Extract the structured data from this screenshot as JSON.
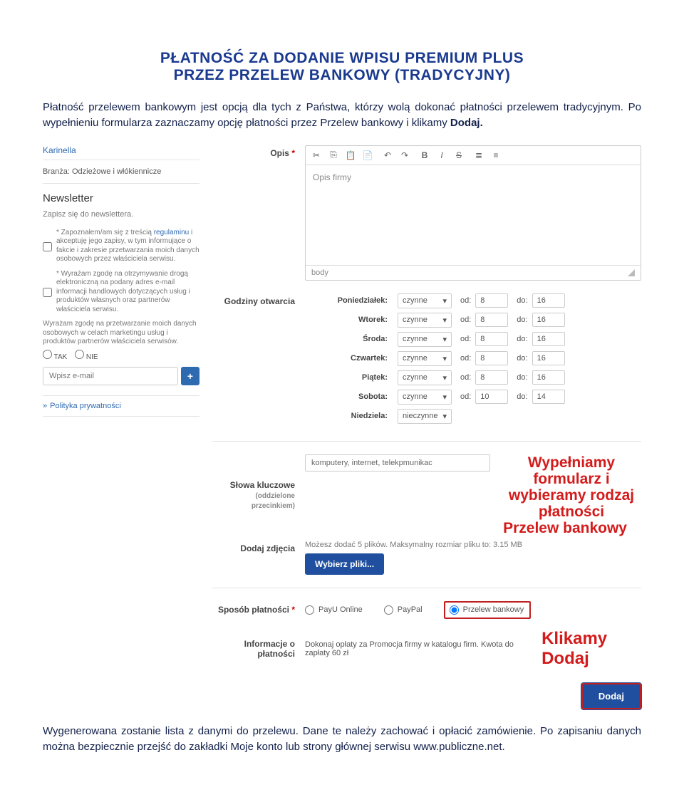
{
  "doc": {
    "title1": "PŁATNOŚĆ ZA DODANIE WPISU PREMIUM PLUS",
    "title2": "PRZEZ PRZELEW BANKOWY (TRADYCYJNY)",
    "para1_pre": "Płatność przelewem bankowym jest opcją dla tych z Państwa, którzy wolą dokonać płatności przelewem tradycyjnym. Po wypełnieniu formularza zaznaczamy opcję płatności przez Przelew bankowy i klikamy ",
    "para1_bold": "Dodaj.",
    "para2": "Wygenerowana zostanie lista z danymi do przelewu. Dane te należy zachować i opłacić zamówienie. Po zapisaniu danych można bezpiecznie przejść do zakładki Moje konto lub strony głównej serwisu www.publiczne.net."
  },
  "sidebar": {
    "breadcrumb": "Karinella",
    "branza_label": "Branża:",
    "branza_value": "Odzieżowe i włókiennicze",
    "newsletter_heading": "Newsletter",
    "newsletter_sub": "Zapisz się do newslettera.",
    "chk1_pre": "* Zapoznałem/am się z treścią ",
    "chk1_link": "regulaminu",
    "chk1_post": " i akceptuję jego zapisy, w tym informujące o fakcie i zakresie przetwarzania moich danych osobowych przez właściciela serwisu.",
    "chk2": "* Wyrażam zgodę na otrzymywanie drogą elektroniczną na podany adres e-mail informacji handlowych dotyczących usług i produktów własnych oraz partnerów właściciela serwisu.",
    "consent_note": "Wyrażam zgodę na przetwarzanie moich danych osobowych w celach marketingu usług i produktów partnerów właściciela serwisów.",
    "radio_yes": "TAK",
    "radio_no": "NIE",
    "email_placeholder": "Wpisz e-mail",
    "plus": "+",
    "privacy": "Polityka prywatności"
  },
  "form": {
    "opis_label": "Opis",
    "req": "*",
    "rte_placeholder": "Opis firmy",
    "rte_footer": "body",
    "hours_label": "Godziny otwarcia",
    "od_label": "od:",
    "do_label": "do:",
    "status_open": "czynne",
    "status_closed": "nieczynne",
    "days": [
      {
        "name": "Poniedziałek:",
        "status": "czynne",
        "od": "8",
        "do": "16"
      },
      {
        "name": "Wtorek:",
        "status": "czynne",
        "od": "8",
        "do": "16"
      },
      {
        "name": "Środa:",
        "status": "czynne",
        "od": "8",
        "do": "16"
      },
      {
        "name": "Czwartek:",
        "status": "czynne",
        "od": "8",
        "do": "16"
      },
      {
        "name": "Piątek:",
        "status": "czynne",
        "od": "8",
        "do": "16"
      },
      {
        "name": "Sobota:",
        "status": "czynne",
        "od": "10",
        "do": "14"
      },
      {
        "name": "Niedziela:",
        "status": "nieczynne",
        "od": "",
        "do": ""
      }
    ],
    "keywords_label": "Słowa kluczowe",
    "keywords_sub": "(oddzielone przecinkiem)",
    "keywords_value": "komputery, internet, telekpmunikac",
    "annotation_fill": "Wypełniamy formularz i wybieramy rodzaj płatności",
    "annotation_fill_sub": "Przelew bankowy",
    "photos_label": "Dodaj zdjęcia",
    "photos_note": "Możesz dodać 5 plików. Maksymalny rozmiar pliku to: 3.15 MB",
    "upload_btn": "Wybierz pliki...",
    "pay_label": "Sposób płatności",
    "pay_opts": [
      "PayU Online",
      "PayPal",
      "Przelew bankowy"
    ],
    "info_label": "Informacje o płatności",
    "info_text": "Dokonaj opłaty za Promocja firmy w katalogu firm. Kwota do zapłaty 60 zł",
    "annotation_click": "Klikamy Dodaj",
    "submit": "Dodaj"
  },
  "icons": {
    "cut": "✂",
    "copy": "⎘",
    "paste": "📋",
    "paste2": "📄",
    "undo": "↶",
    "redo": "↷",
    "bold": "B",
    "italic": "I",
    "strike": "S",
    "list": "≣",
    "olist": "≡",
    "caret": "▾",
    "arrow": "»"
  }
}
